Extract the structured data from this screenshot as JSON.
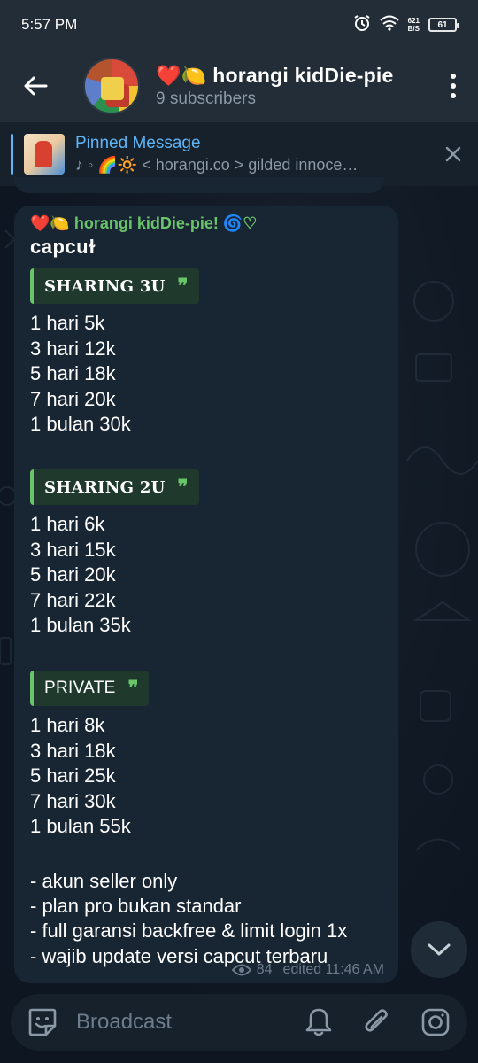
{
  "status_bar": {
    "time": "5:57 PM",
    "speed_value": "621",
    "speed_unit": "B/S",
    "battery": "61"
  },
  "header": {
    "title": "❤️🍋 horangi kidDie-pie",
    "subscribers": "9 subscribers"
  },
  "pinned": {
    "title": "Pinned Message",
    "preview": "♪ ◦ 🌈🔆 < horangi.co > gilded innoce…"
  },
  "message": {
    "sender": "❤️🍋 horangi kidDie-pie! 🌀♡",
    "app": "ᴄapᴄuɫ",
    "blocks": [
      {
        "label": "SHARING 3U",
        "lines": [
          "1 hari 5k",
          "3 hari 12k",
          "5 hari 18k",
          "7 hari 20k",
          "1 bulan 30k"
        ]
      },
      {
        "label": "SHARING 2U",
        "lines": [
          "1 hari 6k",
          "3 hari 15k",
          "5 hari 20k",
          "7 hari 22k",
          "1 bulan 35k"
        ]
      },
      {
        "label": "PRIVATE",
        "lines": [
          "1 hari 8k",
          "3 hari 18k",
          "5 hari 25k",
          "7 hari 30k",
          "1 bulan 55k"
        ]
      }
    ],
    "notes": [
      "- akun seller only",
      "- plan pro bukan standar",
      "- full garansi backfree & limit login 1x",
      "- wajib update versi capcut terbaru"
    ],
    "quote_mark": "❞",
    "views": "84",
    "edited": "edited 11:46 AM"
  },
  "composer": {
    "placeholder": "Broadcast"
  },
  "icons": {
    "back": "back-arrow-icon",
    "menu": "more-vert-icon",
    "close": "close-icon",
    "emoji": "sticker-icon",
    "bell": "bell-icon",
    "attach": "paperclip-icon",
    "camera": "instagram-camera-icon",
    "scroll": "chevron-down-icon"
  },
  "colors": {
    "accent": "#5eb5f7",
    "sender": "#6ac46a",
    "bubble": "#182533",
    "header": "#222d38"
  }
}
